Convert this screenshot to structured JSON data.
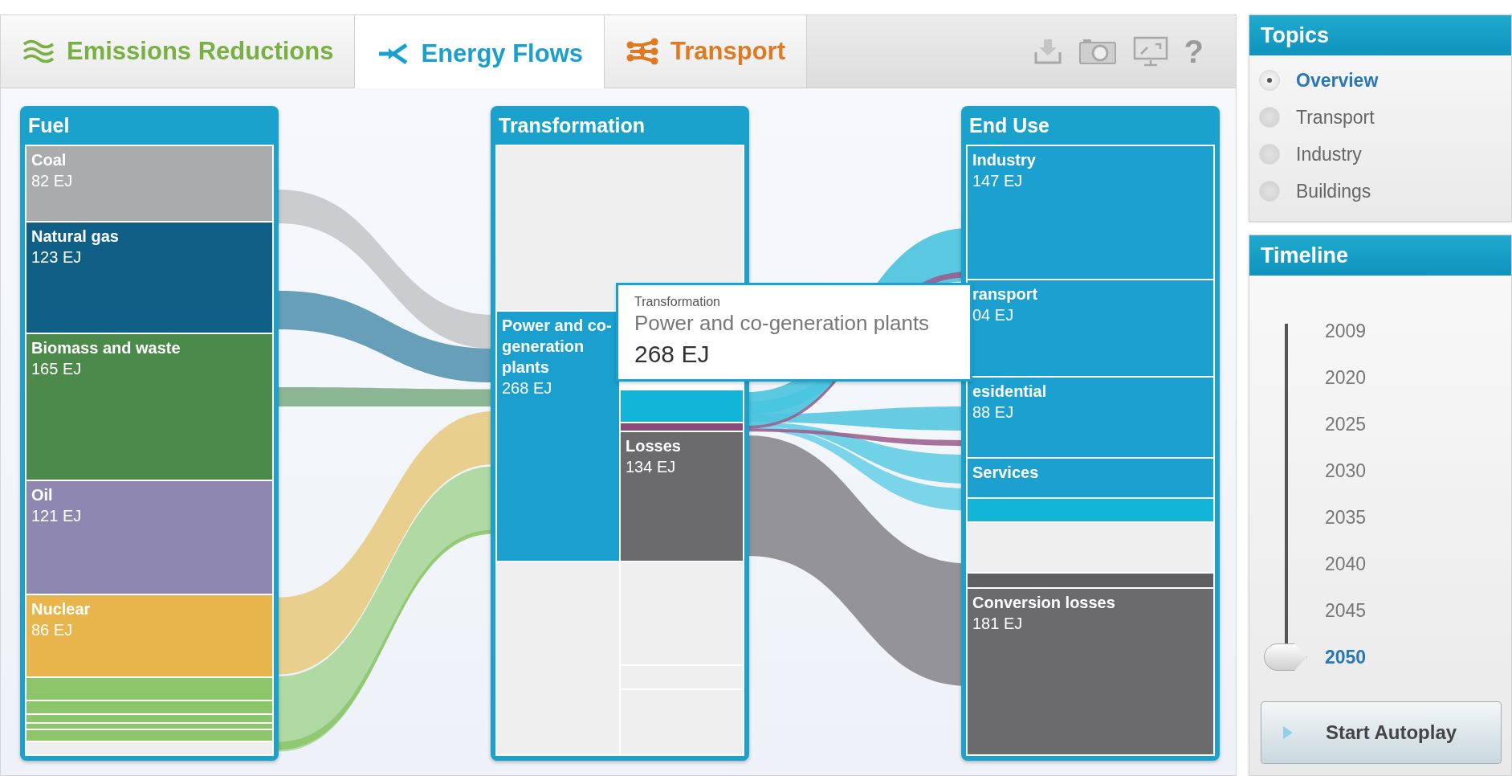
{
  "tabs": [
    {
      "label": "Emissions Reductions",
      "kind": "waves",
      "selected": false,
      "color": "#79b043"
    },
    {
      "label": "Energy Flows",
      "kind": "flow",
      "selected": true,
      "color": "#1a9fcf"
    },
    {
      "label": "Transport",
      "kind": "network",
      "selected": false,
      "color": "#df7a22"
    }
  ],
  "toolbar": {
    "help": "?"
  },
  "diagram": {
    "columns": [
      {
        "title": "Fuel",
        "lanes": [
          [
            {
              "label": "Coal",
              "value": "82 EJ",
              "color": "#a9abad"
            },
            {
              "label": "Natural gas",
              "value": "123 EJ",
              "color": "#0f5f86"
            },
            {
              "label": "Biomass and waste",
              "value": "165 EJ",
              "color": "#4b8a4b"
            },
            {
              "label": "Oil",
              "value": "121 EJ",
              "color": "#8e87b1"
            },
            {
              "label": "Nuclear",
              "value": "86 EJ",
              "color": "#e8b54c"
            },
            {
              "color": "#8cc56a"
            },
            {
              "color": "#8cc56a"
            },
            {
              "color": "#8cc56a"
            },
            {
              "color": "#8cc56a"
            },
            {
              "color": "#8cc56a"
            },
            {
              "color": "#eeeeee"
            }
          ]
        ]
      },
      {
        "title": "Transformation",
        "top": [
          {
            "color": "#efefef"
          }
        ],
        "lanes": [
          [
            {
              "label": "Power and co-generation plants",
              "value": "268 EJ",
              "color": "#1a9fcf"
            },
            {
              "color": "#efefef"
            }
          ],
          [
            {
              "color": "#12b4d8"
            },
            {
              "color": "#8b4b7a"
            },
            {
              "label": "Losses",
              "value": "134 EJ",
              "color": "#6b6b6e"
            },
            {
              "color": "#efefef"
            },
            {
              "color": "#efefef"
            },
            {
              "color": "#efefef"
            }
          ]
        ]
      },
      {
        "title": "End Use",
        "lanes": [
          [
            {
              "label": "Industry",
              "value": "147 EJ",
              "color": "#1ca0d0"
            },
            {
              "label": "ransport",
              "value": "04 EJ",
              "color": "#1ca0d0"
            },
            {
              "label": "esidential",
              "value": "88 EJ",
              "color": "#1ca0d0"
            },
            {
              "label": "Services",
              "color": "#1ca0d0"
            },
            {
              "color": "#12b4d8"
            },
            {
              "color": "#efefef"
            },
            {
              "color": "#5f5f62"
            },
            {
              "label": "Conversion losses",
              "value": "181 EJ",
              "color": "#6b6b6e"
            }
          ]
        ]
      }
    ],
    "tooltip": {
      "category": "Transformation",
      "name": "Power and co-generation plants",
      "value": "268 EJ"
    }
  },
  "topics": {
    "title": "Topics",
    "items": [
      {
        "label": "Overview",
        "selected": true
      },
      {
        "label": "Transport",
        "selected": false
      },
      {
        "label": "Industry",
        "selected": false
      },
      {
        "label": "Buildings",
        "selected": false
      }
    ]
  },
  "timeline": {
    "title": "Timeline",
    "years": [
      {
        "label": "2009",
        "selected": false
      },
      {
        "label": "2020",
        "selected": false
      },
      {
        "label": "2025",
        "selected": false
      },
      {
        "label": "2030",
        "selected": false
      },
      {
        "label": "2035",
        "selected": false
      },
      {
        "label": "2040",
        "selected": false
      },
      {
        "label": "2045",
        "selected": false
      },
      {
        "label": "2050",
        "selected": true
      }
    ]
  },
  "autoplay": {
    "label": "Start Autoplay"
  }
}
